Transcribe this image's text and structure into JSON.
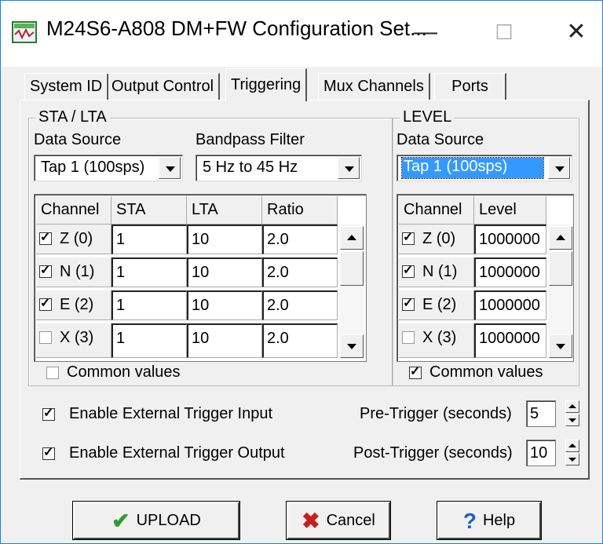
{
  "window": {
    "title": "M24S6-A808 DM+FW Configuration Set...",
    "controls": {
      "minimize": "—",
      "maximize": "☐",
      "close": "✕"
    }
  },
  "tabs": [
    "System ID",
    "Output Control",
    "Triggering",
    "Mux Channels",
    "Ports"
  ],
  "active_tab": "Triggering",
  "sta_lta": {
    "title": "STA / LTA",
    "data_source_label": "Data Source",
    "data_source_value": "Tap 1 (100sps)",
    "bandpass_label": "Bandpass Filter",
    "bandpass_value": "5 Hz to 45 Hz",
    "columns": [
      "Channel",
      "STA",
      "LTA",
      "Ratio"
    ],
    "rows": [
      {
        "channel": "Z (0)",
        "checked": true,
        "sta": "1",
        "lta": "10",
        "ratio": "2.0"
      },
      {
        "channel": "N (1)",
        "checked": true,
        "sta": "1",
        "lta": "10",
        "ratio": "2.0"
      },
      {
        "channel": "E (2)",
        "checked": true,
        "sta": "1",
        "lta": "10",
        "ratio": "2.0"
      },
      {
        "channel": "X (3)",
        "checked": false,
        "sta": "1",
        "lta": "10",
        "ratio": "2.0"
      }
    ],
    "common_values_label": "Common values",
    "common_values_checked": false
  },
  "level": {
    "title": "LEVEL",
    "data_source_label": "Data Source",
    "data_source_value": "Tap 1 (100sps)",
    "columns": [
      "Channel",
      "Level"
    ],
    "rows": [
      {
        "channel": "Z (0)",
        "checked": true,
        "level": "1000000"
      },
      {
        "channel": "N (1)",
        "checked": true,
        "level": "1000000"
      },
      {
        "channel": "E (2)",
        "checked": true,
        "level": "1000000"
      },
      {
        "channel": "X (3)",
        "checked": false,
        "level": "1000000"
      }
    ],
    "common_values_label": "Common values",
    "common_values_checked": true
  },
  "external_trigger": {
    "input_label": "Enable External Trigger Input",
    "input_checked": true,
    "output_label": "Enable External Trigger Output",
    "output_checked": true,
    "pre_trigger_label": "Pre-Trigger (seconds)",
    "pre_trigger_value": "5",
    "post_trigger_label": "Post-Trigger (seconds)",
    "post_trigger_value": "10"
  },
  "buttons": {
    "upload": "UPLOAD",
    "cancel": "Cancel",
    "help": "Help"
  },
  "colors": {
    "selection": "#3399ff",
    "upload_icon": "#2e9e2e",
    "cancel_icon": "#c81e1e",
    "help_icon": "#1e5fc8"
  }
}
